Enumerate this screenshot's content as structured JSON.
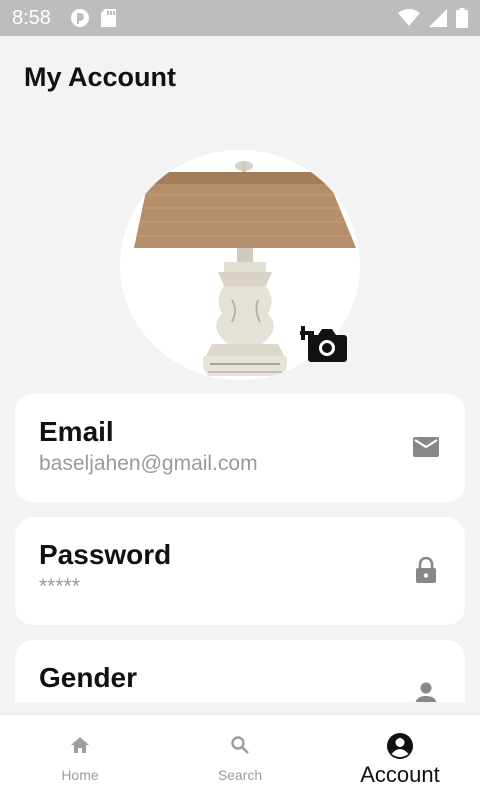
{
  "status_bar": {
    "time": "8:58",
    "left_icons": [
      "pocket-icon",
      "sd-card-icon"
    ],
    "right_icons": [
      "wifi-icon",
      "signal-icon",
      "battery-icon"
    ]
  },
  "page": {
    "title": "My Account"
  },
  "profile": {
    "avatar_icon": "lamp-photo",
    "camera_icon": "add-a-photo-icon"
  },
  "fields": [
    {
      "label": "Email",
      "value": "baseljahen@gmail.com",
      "icon": "mail-icon"
    },
    {
      "label": "Password",
      "value": "*****",
      "icon": "lock-icon"
    },
    {
      "label": "Gender",
      "value": "",
      "icon": "person-icon"
    }
  ],
  "bottom_nav": {
    "items": [
      {
        "label": "Home",
        "icon": "home-icon",
        "active": false
      },
      {
        "label": "Search",
        "icon": "search-icon",
        "active": false
      },
      {
        "label": "Account",
        "icon": "account-circle-icon",
        "active": true
      }
    ]
  },
  "colors": {
    "background": "#f3f3f3",
    "status_bar": "#bdbdbd",
    "card": "#ffffff",
    "muted_text": "#9a9a9a",
    "icon_gray": "#888888"
  }
}
